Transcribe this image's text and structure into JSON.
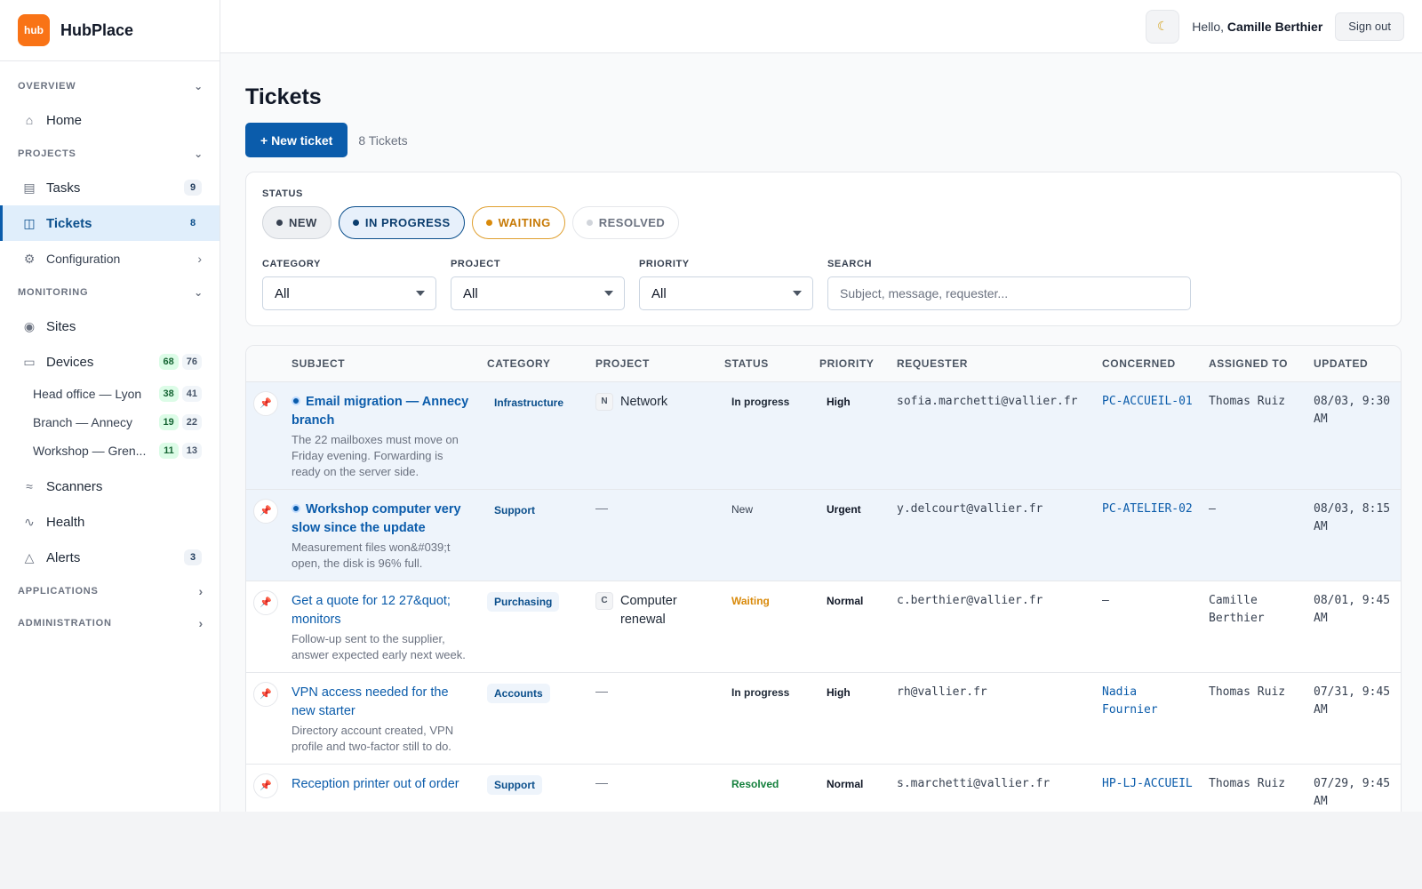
{
  "brand": {
    "logo_text": "hub",
    "name": "HubPlace"
  },
  "sidebar": {
    "sections": {
      "overview": "OVERVIEW",
      "projects": "PROJECTS",
      "monitoring": "MONITORING",
      "applications": "APPLICATIONS",
      "administration": "ADMINISTRATION"
    },
    "items": {
      "home": {
        "label": "Home",
        "icon": "home-icon"
      },
      "tasks": {
        "label": "Tasks",
        "badge": "9",
        "icon": "clipboard-icon"
      },
      "tickets": {
        "label": "Tickets",
        "badge": "8",
        "icon": "ticket-icon"
      },
      "configuration": {
        "label": "Configuration",
        "icon": "gear-icon"
      },
      "sites": {
        "label": "Sites",
        "icon": "map-pin-icon"
      },
      "devices": {
        "label": "Devices",
        "badge_green": "68",
        "badge_gray": "76",
        "icon": "monitor-icon"
      },
      "scanners": {
        "label": "Scanners",
        "icon": "wifi-icon"
      },
      "health": {
        "label": "Health",
        "icon": "pulse-icon"
      },
      "alerts": {
        "label": "Alerts",
        "badge": "3",
        "icon": "warning-icon"
      }
    },
    "sites": [
      {
        "label": "Head office — Lyon",
        "online": "38",
        "total": "41"
      },
      {
        "label": "Branch — Annecy",
        "online": "19",
        "total": "22"
      },
      {
        "label": "Workshop — Gren...",
        "online": "11",
        "total": "13"
      }
    ]
  },
  "topbar": {
    "greeting": "Hello,",
    "user": "Camille Berthier",
    "sign_out": "Sign out",
    "theme_icon": "moon-icon"
  },
  "page": {
    "title": "Tickets",
    "new_button": "+ New ticket",
    "count": "8 Tickets"
  },
  "filters": {
    "status_label": "STATUS",
    "statuses": [
      "NEW",
      "IN PROGRESS",
      "WAITING",
      "RESOLVED"
    ],
    "category": {
      "label": "CATEGORY",
      "value": "All"
    },
    "project": {
      "label": "PROJECT",
      "value": "All"
    },
    "priority": {
      "label": "PRIORITY",
      "value": "All"
    },
    "search": {
      "label": "SEARCH",
      "placeholder": "Subject, message, requester..."
    }
  },
  "table": {
    "headers": [
      "SUBJECT",
      "CATEGORY",
      "PROJECT",
      "STATUS",
      "PRIORITY",
      "REQUESTER",
      "CONCERNED",
      "ASSIGNED TO",
      "UPDATED"
    ],
    "rows": [
      {
        "subject": "Email migration — Annecy branch",
        "desc": "The 22 mailboxes must move on Friday evening. Forwarding is ready on the server side.",
        "category": "Infrastructure",
        "project_initial": "N",
        "project": "Network",
        "status": "In progress",
        "priority": "High",
        "requester": "sofia.marchetti@vallier.fr",
        "concerned": "PC-ACCUEIL-01",
        "assigned": "Thomas Ruiz",
        "updated": "08/03, 9:30 AM"
      },
      {
        "subject": "Workshop computer very slow since the update",
        "desc": "Measurement files won&#039;t open, the disk is 96% full.",
        "category": "Support",
        "project": "—",
        "status": "New",
        "priority": "Urgent",
        "requester": "y.delcourt@vallier.fr",
        "concerned": "PC-ATELIER-02",
        "assigned": "—",
        "updated": "08/03, 8:15 AM"
      },
      {
        "subject": "Get a quote for 12 27&quot; monitors",
        "desc": "Follow-up sent to the supplier, answer expected early next week.",
        "category": "Purchasing",
        "project_initial": "C",
        "project": "Computer renewal",
        "status": "Waiting",
        "priority": "Normal",
        "requester": "c.berthier@vallier.fr",
        "concerned": "—",
        "assigned": "Camille Berthier",
        "updated": "08/01, 9:45 AM"
      },
      {
        "subject": "VPN access needed for the new starter",
        "desc": "Directory account created, VPN profile and two-factor still to do.",
        "category": "Accounts",
        "project": "—",
        "status": "In progress",
        "priority": "High",
        "requester": "rh@vallier.fr",
        "concerned": "Nadia Fournier",
        "assigned": "Thomas Ruiz",
        "updated": "07/31, 9:45 AM"
      },
      {
        "subject": "Reception printer out of order",
        "desc": "",
        "category": "Support",
        "project": "—",
        "status": "Resolved",
        "priority": "Normal",
        "requester": "s.marchetti@vallier.fr",
        "concerned": "HP-LJ-ACCUEIL",
        "assigned": "Thomas Ruiz",
        "updated": "07/29, 9:45 AM"
      }
    ]
  },
  "colors": {
    "primary": "#0b5cab",
    "accent": "#f97316",
    "waiting": "#d98a0b",
    "resolved": "#15803d",
    "pin": "#b91c1c"
  }
}
